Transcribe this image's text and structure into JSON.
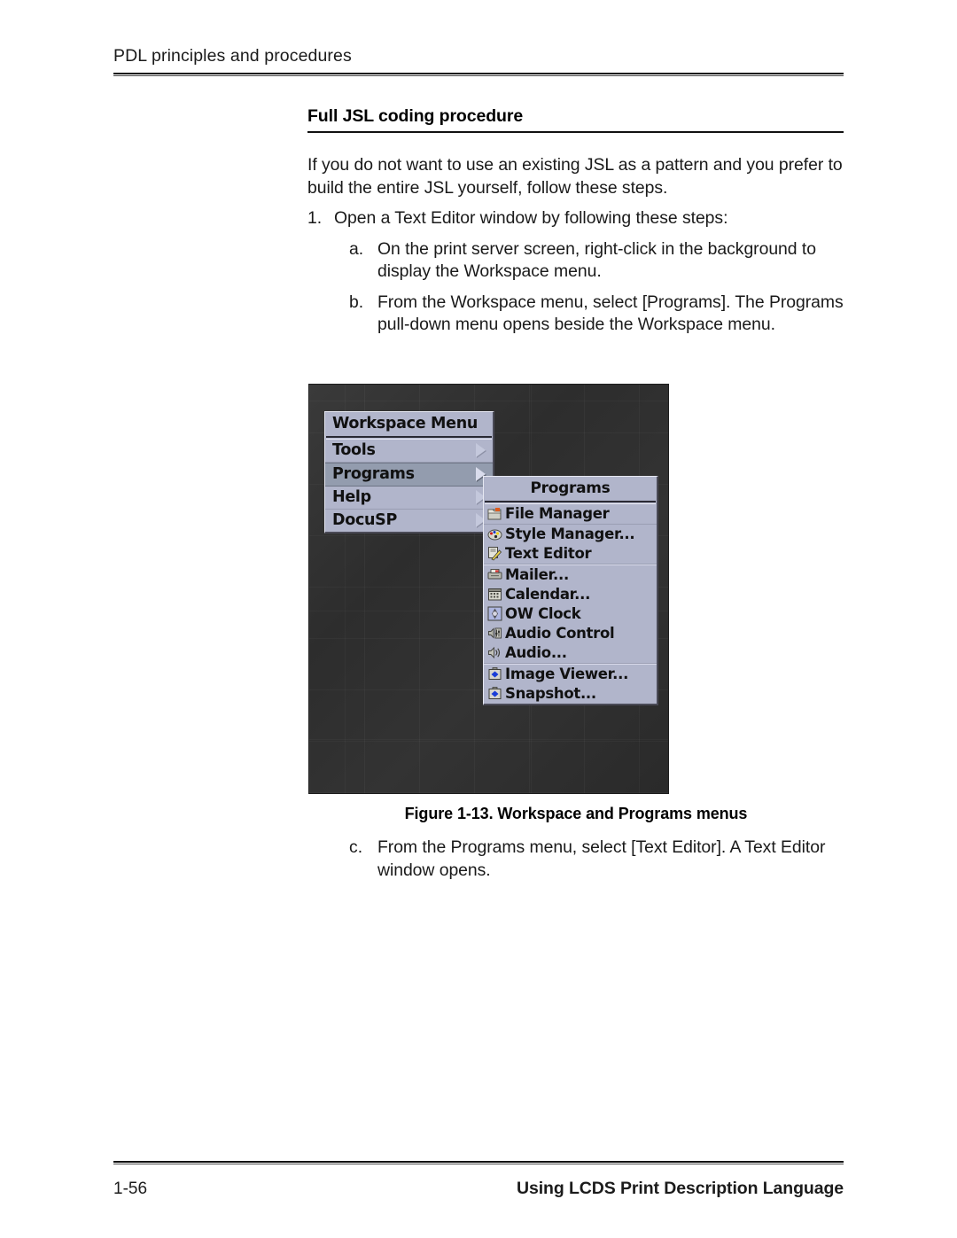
{
  "header": {
    "running_head": "PDL principles and procedures"
  },
  "section": {
    "heading": "Full JSL coding procedure"
  },
  "body": {
    "intro": "If you do not want to use an existing JSL as a pattern and you prefer to build the entire JSL yourself, follow these steps.",
    "steps": [
      {
        "marker": "1.",
        "text": "Open a Text Editor window by following these steps:",
        "level": 1
      },
      {
        "marker": "a.",
        "text": "On the print server screen, right-click in the background to display the Workspace menu.",
        "level": 2
      },
      {
        "marker": "b.",
        "text": "From the Workspace menu, select [Programs]. The Programs pull-down menu opens beside the Workspace menu.",
        "level": 2
      }
    ],
    "steps_after_figure": [
      {
        "marker": "c.",
        "text": "From the Programs menu, select [Text Editor]. A Text Editor window opens.",
        "level": 2
      }
    ]
  },
  "figure": {
    "caption": "Figure 1-13.  Workspace and Programs menus",
    "colors": {
      "desktop_background": "#303030",
      "menu_background": "#b1b5cb",
      "menu_highlight": "#939cae",
      "menu_text": "#111111",
      "menu_border_light": "#e6e8f2",
      "menu_border_dark": "#4a4a56"
    },
    "workspace_menu": {
      "title": "Workspace Menu",
      "items": [
        {
          "label": "Tools",
          "has_submenu": true,
          "highlighted": false
        },
        {
          "label": "Programs",
          "has_submenu": true,
          "highlighted": true
        },
        {
          "label": "Help",
          "has_submenu": true,
          "highlighted": false
        },
        {
          "label": "DocuSP",
          "has_submenu": true,
          "highlighted": false
        }
      ]
    },
    "programs_menu": {
      "title": "Programs",
      "items": [
        {
          "label": "File Manager",
          "icon": "folder-icon",
          "group": 1
        },
        {
          "label": "Style Manager...",
          "icon": "palette-icon",
          "group": 1
        },
        {
          "label": "Text Editor",
          "icon": "pencil-note-icon",
          "group": 1
        },
        {
          "label": "Mailer...",
          "icon": "mailer-icon",
          "group": 2
        },
        {
          "label": "Calendar...",
          "icon": "calendar-icon",
          "group": 2
        },
        {
          "label": "OW Clock",
          "icon": "clock-diamond-icon",
          "group": 2
        },
        {
          "label": "Audio Control",
          "icon": "audio-control-icon",
          "group": 2
        },
        {
          "label": "Audio...",
          "icon": "speaker-icon",
          "group": 2
        },
        {
          "label": "Image Viewer...",
          "icon": "image-viewer-icon",
          "group": 3
        },
        {
          "label": "Snapshot...",
          "icon": "snapshot-icon",
          "group": 3
        }
      ]
    }
  },
  "footer": {
    "page_number": "1-56",
    "document_title": "Using LCDS Print Description Language"
  }
}
